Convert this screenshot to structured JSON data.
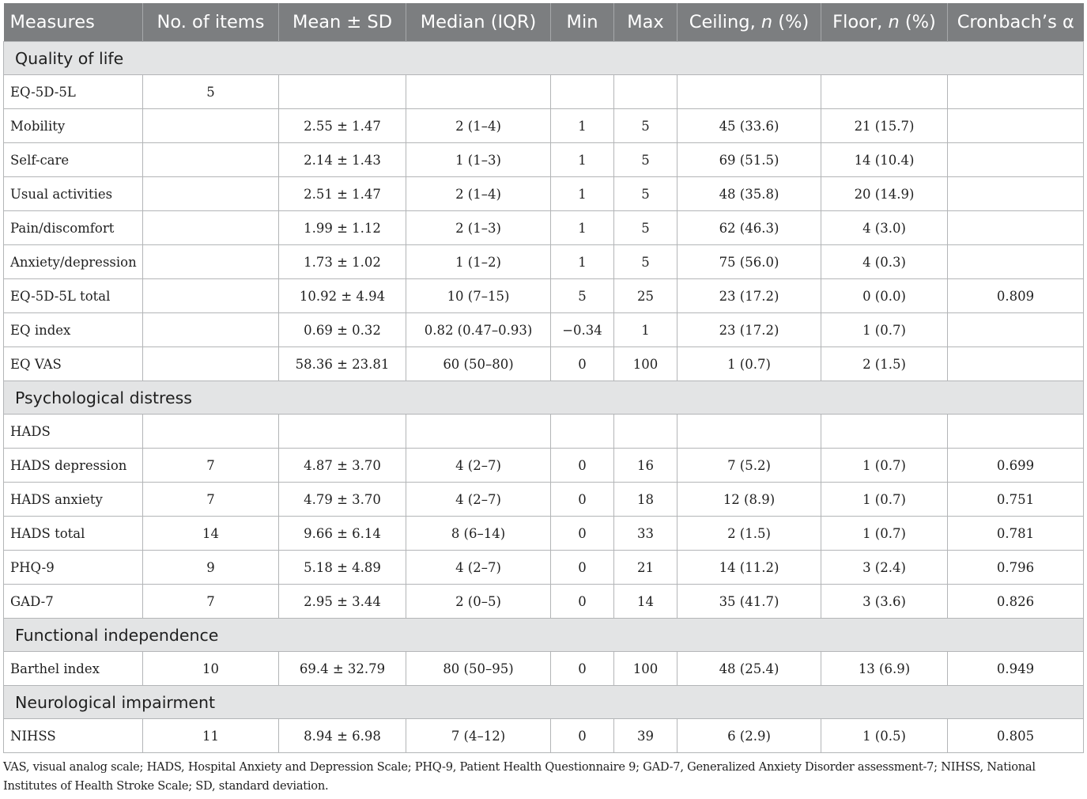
{
  "table": {
    "headers": [
      "Measures",
      "No. of items",
      "Mean ± SD",
      "Median (IQR)",
      "Min",
      "Max",
      "Ceiling, n (%)",
      "Floor, n (%)",
      "Cronbach’s α"
    ],
    "sections": [
      {
        "title": "Quality of life",
        "rows": [
          [
            "EQ-5D-5L",
            "5",
            "",
            "",
            "",
            "",
            "",
            "",
            ""
          ],
          [
            "Mobility",
            "",
            "2.55 ± 1.47",
            "2 (1–4)",
            "1",
            "5",
            "45 (33.6)",
            "21 (15.7)",
            ""
          ],
          [
            "Self-care",
            "",
            "2.14 ± 1.43",
            "1 (1–3)",
            "1",
            "5",
            "69 (51.5)",
            "14 (10.4)",
            ""
          ],
          [
            "Usual activities",
            "",
            "2.51 ± 1.47",
            "2 (1–4)",
            "1",
            "5",
            "48 (35.8)",
            "20 (14.9)",
            ""
          ],
          [
            "Pain/discomfort",
            "",
            "1.99 ± 1.12",
            "2 (1–3)",
            "1",
            "5",
            "62 (46.3)",
            "4 (3.0)",
            ""
          ],
          [
            "Anxiety/depression",
            "",
            "1.73 ± 1.02",
            "1 (1–2)",
            "1",
            "5",
            "75 (56.0)",
            "4 (0.3)",
            ""
          ],
          [
            "EQ-5D-5L total",
            "",
            "10.92 ± 4.94",
            "10 (7–15)",
            "5",
            "25",
            "23 (17.2)",
            "0 (0.0)",
            "0.809"
          ],
          [
            "EQ index",
            "",
            "0.69 ± 0.32",
            "0.82 (0.47–0.93)",
            "−0.34",
            "1",
            "23 (17.2)",
            "1 (0.7)",
            ""
          ],
          [
            "EQ VAS",
            "",
            "58.36 ± 23.81",
            "60 (50–80)",
            "0",
            "100",
            "1 (0.7)",
            "2 (1.5)",
            ""
          ]
        ]
      },
      {
        "title": "Psychological distress",
        "rows": [
          [
            "HADS",
            "",
            "",
            "",
            "",
            "",
            "",
            "",
            ""
          ],
          [
            "HADS depression",
            "7",
            "4.87 ± 3.70",
            "4 (2–7)",
            "0",
            "16",
            "7 (5.2)",
            "1 (0.7)",
            "0.699"
          ],
          [
            "HADS anxiety",
            "7",
            "4.79 ± 3.70",
            "4 (2–7)",
            "0",
            "18",
            "12 (8.9)",
            "1 (0.7)",
            "0.751"
          ],
          [
            "HADS total",
            "14",
            "9.66 ± 6.14",
            "8 (6–14)",
            "0",
            "33",
            "2 (1.5)",
            "1 (0.7)",
            "0.781"
          ],
          [
            "PHQ-9",
            "9",
            "5.18 ± 4.89",
            "4 (2–7)",
            "0",
            "21",
            "14 (11.2)",
            "3 (2.4)",
            "0.796"
          ],
          [
            "GAD-7",
            "7",
            "2.95 ± 3.44",
            "2 (0–5)",
            "0",
            "14",
            "35 (41.7)",
            "3 (3.6)",
            "0.826"
          ]
        ]
      },
      {
        "title": "Functional independence",
        "rows": [
          [
            "Barthel index",
            "10",
            "69.4 ± 32.79",
            "80 (50–95)",
            "0",
            "100",
            "48 (25.4)",
            "13 (6.9)",
            "0.949"
          ]
        ]
      },
      {
        "title": "Neurological impairment",
        "rows": [
          [
            "NIHSS",
            "11",
            "8.94 ± 6.98",
            "7 (4–12)",
            "0",
            "39",
            "6 (2.9)",
            "1 (0.5)",
            "0.805"
          ]
        ]
      }
    ]
  },
  "footnote": "VAS, visual analog scale; HADS, Hospital Anxiety and Depression Scale; PHQ-9, Patient Health Questionnaire 9; GAD-7, Generalized Anxiety Disorder assessment-7; NIHSS, National Institutes of Health Stroke Scale; SD, standard deviation."
}
